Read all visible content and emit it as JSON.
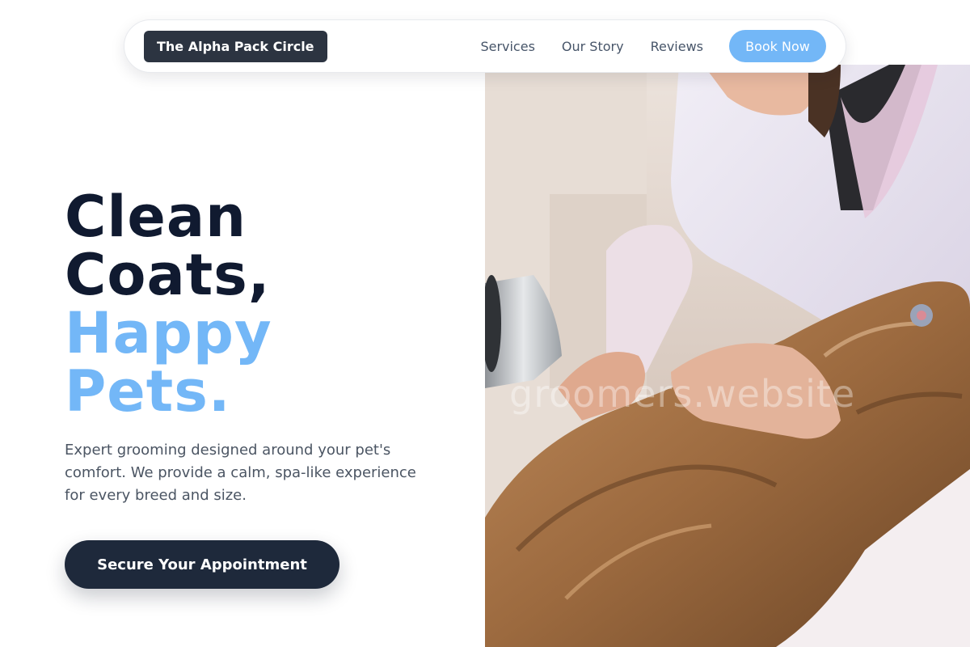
{
  "nav": {
    "brand": "The Alpha Pack Circle",
    "links": [
      "Services",
      "Our Story",
      "Reviews"
    ],
    "cta_label": "Book Now"
  },
  "hero": {
    "headline_line1": "Clean",
    "headline_line2": "Coats,",
    "headline_accent1": "Happy",
    "headline_accent2": "Pets.",
    "description": "Expert grooming designed around your pet's comfort. We provide a calm, spa-like experience for every breed and size.",
    "cta_label": "Secure Your Appointment",
    "image_alt": "Groomer blow-drying a long-haired dog",
    "watermark": "groomers.website"
  },
  "colors": {
    "accent": "#73b7f7",
    "dark": "#1e293b",
    "heading": "#101a30",
    "brand_bg": "#2c3441"
  },
  "icons": []
}
